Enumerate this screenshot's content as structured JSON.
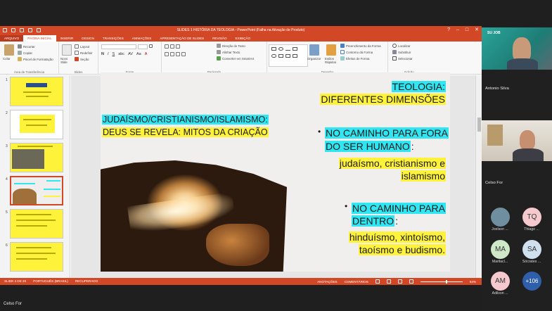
{
  "window": {
    "title": "SLIDES 1 HISTÓRIA DA TEOLOGIA - PowerPoint (Falha na Ativação de Produto)",
    "controls": [
      "?",
      "–",
      "□",
      "✕"
    ]
  },
  "ribbon_tabs": [
    "ARQUIVO",
    "PÁGINA INICIAL",
    "INSERIR",
    "DESIGN",
    "TRANSIÇÕES",
    "ANIMAÇÕES",
    "APRESENTAÇÃO DE SLIDES",
    "REVISÃO",
    "EXIBIÇÃO"
  ],
  "ribbon": {
    "clipboard": {
      "paste": "Colar",
      "cut": "Recortar",
      "copy": "Copiar",
      "format_painter": "Pincel de Formatação",
      "group": "Área de Transferência"
    },
    "slides": {
      "new_slide": "Novo Slide",
      "layout": "Layout",
      "reset": "Redefinir",
      "section": "Seção",
      "group": "Slides"
    },
    "font": {
      "format_buttons": [
        "N",
        "I",
        "S",
        "abc",
        "AV",
        "Aa",
        "A"
      ],
      "group": "Fonte"
    },
    "paragraph": {
      "text_direction": "Direção do Texto",
      "align_text": "Alinhar Texto",
      "smartart": "Converter em SmartArt",
      "group": "Parágrafo"
    },
    "drawing": {
      "arrange": "Organizar",
      "quick_styles": "Estilos Rápidos",
      "fill": "Preenchimento da Forma",
      "outline": "Contorno da Forma",
      "effects": "Efeitos de Forma",
      "group": "Desenho"
    },
    "editing": {
      "find": "Localizar",
      "replace": "Substituir",
      "select": "Selecionar",
      "group": "Edição"
    }
  },
  "thumbnails": {
    "numbers": [
      "1",
      "2",
      "3",
      "4",
      "5",
      "6"
    ],
    "selected": "4"
  },
  "slide": {
    "left_heading_line1": "JUDAÍSMO/CRISTIANISMO/ISLAMISMO:",
    "left_heading_line2": "DEUS SE REVELA: MITOS DA CRIAÇÃO",
    "title_line1": "TEOLOGIA:",
    "title_line2": "DIFERENTES DIMENSÕES",
    "bullet1_line1": "NO CAMINHO PARA FORA",
    "bullet1_line2": "DO SER HUMANO",
    "bullet1_colon": ":",
    "body1_line1": "judaísmo, cristianismo e",
    "body1_line2": "islamismo",
    "bullet2_line1": "NO CAMINHO PARA",
    "bullet2_line2": "DENTRO",
    "bullet2_colon": ":",
    "body2_line1": "hinduísmo, xintoísmo,",
    "body2_line2": "taoísmo e budismo.",
    "bullet_char": "•"
  },
  "statusbar": {
    "slide_count": "SLIDE 4 DE 20",
    "language": "PORTUGUÊS (BRASIL)",
    "recovered": "RECUPERADO",
    "notes": "ANOTAÇÕES",
    "comments": "COMENTÁRIOS",
    "zoom": "92%"
  },
  "meeting": {
    "participants": [
      {
        "name": "Antonio Silva"
      },
      {
        "name": "Celso For"
      }
    ],
    "avatars": [
      {
        "initials": "",
        "name": "Joelson ...",
        "color": "#6f8fa0"
      },
      {
        "initials": "TQ",
        "name": "Thiago ...",
        "color": "#f6c9cf"
      },
      {
        "initials": "MA",
        "name": "Marilacl...",
        "color": "#cfe8c8"
      },
      {
        "initials": "SA",
        "name": "Sócrates ...",
        "color": "#cfe0ef"
      },
      {
        "initials": "AM",
        "name": "Adilson ...",
        "color": "#f6c9cf"
      },
      {
        "initials": "+106",
        "name": "",
        "color": "#2f5faa"
      }
    ],
    "presenter_label": "Celso For",
    "logo_text": "SU JOB"
  },
  "colors": {
    "ppt_accent": "#d24726",
    "highlight_cyan": "#30e6f2",
    "highlight_yellow": "#fff23a"
  }
}
